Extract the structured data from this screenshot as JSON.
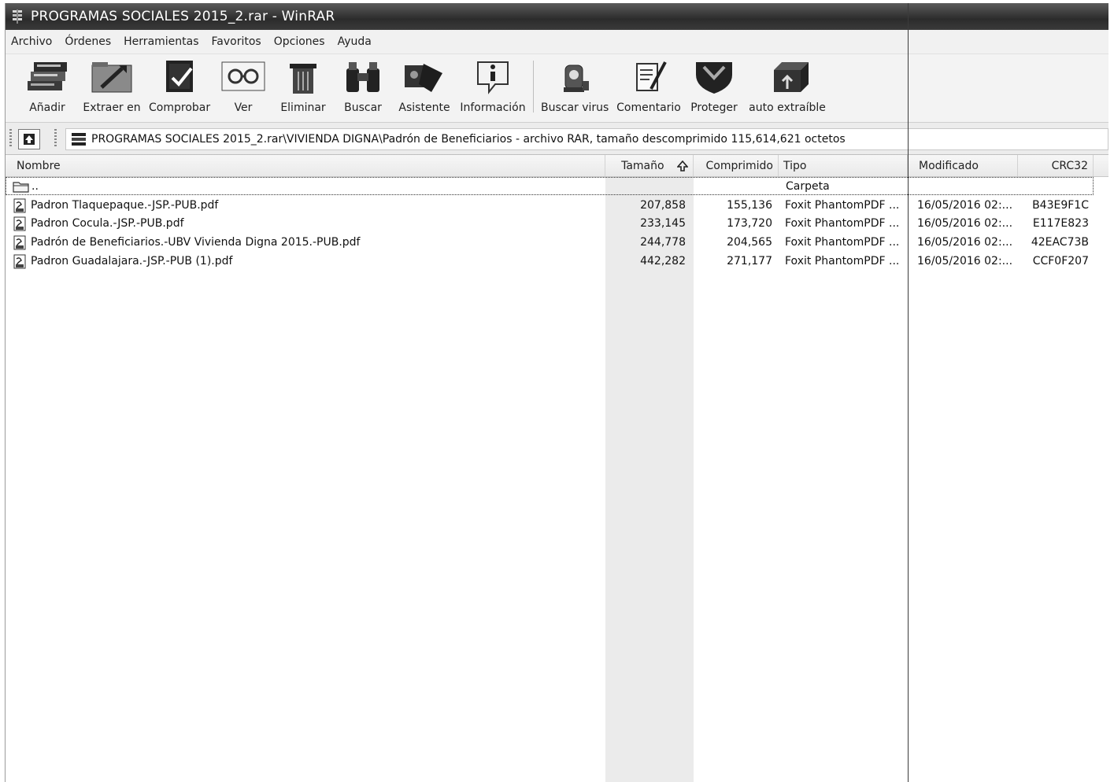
{
  "window": {
    "title": "PROGRAMAS SOCIALES 2015_2.rar - WinRAR"
  },
  "menu": [
    "Archivo",
    "Órdenes",
    "Herramientas",
    "Favoritos",
    "Opciones",
    "Ayuda"
  ],
  "toolbar": [
    {
      "label": "Añadir",
      "icon": "add-books-icon"
    },
    {
      "label": "Extraer en",
      "icon": "extract-folder-icon"
    },
    {
      "label": "Comprobar",
      "icon": "test-book-icon"
    },
    {
      "label": "Ver",
      "icon": "view-glasses-icon"
    },
    {
      "label": "Eliminar",
      "icon": "delete-trash-icon"
    },
    {
      "label": "Buscar",
      "icon": "binoculars-icon"
    },
    {
      "label": "Asistente",
      "icon": "wizard-icon"
    },
    {
      "label": "Información",
      "icon": "info-icon"
    },
    {
      "label": "Buscar virus",
      "icon": "virus-scan-icon"
    },
    {
      "label": "Comentario",
      "icon": "comment-icon"
    },
    {
      "label": "Proteger",
      "icon": "shield-icon"
    },
    {
      "label": "auto extraíble",
      "icon": "sfx-box-icon"
    }
  ],
  "address": {
    "path": "PROGRAMAS SOCIALES 2015_2.rar\\VIVIENDA DIGNA\\Padrón de Beneficiarios - archivo RAR, tamaño descomprimido 115,614,621 octetos"
  },
  "columns": {
    "name": "Nombre",
    "size": "Tamaño",
    "packed": "Comprimido",
    "type": "Tipo",
    "modified": "Modificado",
    "crc": "CRC32"
  },
  "parent_row": {
    "name": "..",
    "type": "Carpeta"
  },
  "files": [
    {
      "name": "Padron Tlaquepaque.-JSP.-PUB.pdf",
      "size": "207,858",
      "packed": "155,136",
      "type": "Foxit PhantomPDF ...",
      "modified": "16/05/2016 02:...",
      "crc": "B43E9F1C"
    },
    {
      "name": "Padron Cocula.-JSP.-PUB.pdf",
      "size": "233,145",
      "packed": "173,720",
      "type": "Foxit PhantomPDF ...",
      "modified": "16/05/2016 02:...",
      "crc": "E117E823"
    },
    {
      "name": "Padrón de Beneficiarios.-UBV Vivienda Digna 2015.-PUB.pdf",
      "size": "244,778",
      "packed": "204,565",
      "type": "Foxit PhantomPDF ...",
      "modified": "16/05/2016 02:...",
      "crc": "42EAC73B"
    },
    {
      "name": "Padron Guadalajara.-JSP.-PUB (1).pdf",
      "size": "442,282",
      "packed": "271,177",
      "type": "Foxit PhantomPDF ...",
      "modified": "16/05/2016 02:...",
      "crc": "CCF0F207"
    }
  ]
}
